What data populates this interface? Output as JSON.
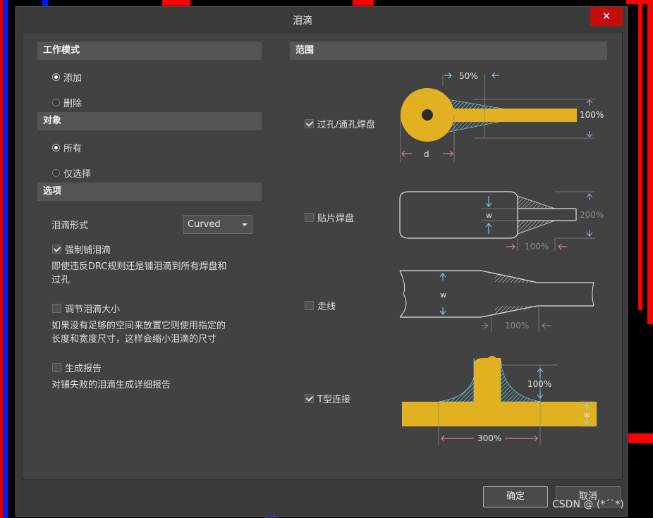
{
  "window": {
    "title": "泪滴",
    "close_symbol": "✕"
  },
  "left": {
    "work_mode": {
      "header": "工作模式",
      "options": [
        {
          "label": "添加",
          "checked": true
        },
        {
          "label": "删除",
          "checked": false
        }
      ]
    },
    "target": {
      "header": "对象",
      "options": [
        {
          "label": "所有",
          "checked": true
        },
        {
          "label": "仅选择",
          "checked": false
        }
      ]
    },
    "options": {
      "header": "选项",
      "style_label": "泪滴形式",
      "style_value": "Curved",
      "force": {
        "label": "强制铺泪滴",
        "checked": true,
        "desc_line1": "即使违反DRC规则还是铺泪滴到所有焊盘和",
        "desc_line2": "过孔"
      },
      "adjust": {
        "label": "调节泪滴大小",
        "checked": false,
        "desc_line1": "如果没有足够的空间来放置它则使用指定的",
        "desc_line2": "长度和宽度尺寸，这样会缩小泪滴的尺寸"
      },
      "report": {
        "label": "生成报告",
        "checked": false,
        "desc": "对铺失败的泪滴生成详细报告"
      }
    }
  },
  "right": {
    "header": "范围",
    "via": {
      "label": "过孔/通孔焊盘",
      "checked": true,
      "pct_len": "50%",
      "pct_width": "100%",
      "dim": "d"
    },
    "smd": {
      "label": "贴片焊盘",
      "checked": false,
      "pct_width": "200%",
      "pct_len": "100%",
      "dim": "w"
    },
    "track": {
      "label": "走线",
      "checked": false,
      "pct_len": "100%",
      "dim": "w"
    },
    "tjunction": {
      "label": "T型连接",
      "checked": true,
      "pct_height": "100%",
      "pct_len": "300%",
      "dim": "w"
    }
  },
  "footer": {
    "ok_label": "确定",
    "cancel_label": "取消"
  },
  "watermark": "CSDN @ (*´`*)",
  "colors": {
    "copper": "#e2b121",
    "hatch": "#7fe3f0",
    "trace_red": "#ff0000",
    "trace_blue": "#0000ff",
    "close_red": "#c40c0c"
  }
}
